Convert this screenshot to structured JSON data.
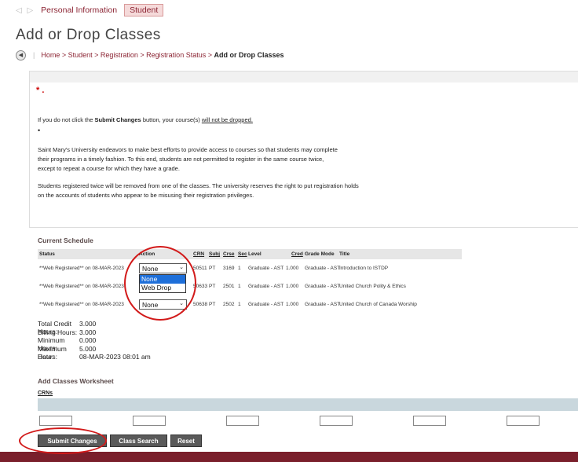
{
  "nav": {
    "arrows": "◁ ▷",
    "tab_personal": "Personal Information",
    "tab_student": "Student"
  },
  "page_title": "Add or Drop Classes",
  "breadcrumb": {
    "back": "◀",
    "sep": "|",
    "path": "Home > Student > Registration > Registration Status > ",
    "current": "Add or Drop Classes"
  },
  "info": {
    "star": "* .",
    "submit_pre": "If you do not click the ",
    "submit_bold": "Submit Changes",
    "submit_mid": " button, your course(s) ",
    "submit_underline": "will not be dropped.",
    "bullet": "•",
    "p1_line1": "Saint Mary's University endeavors to make best efforts to provide access to courses so that students may complete",
    "p1_line2": "their programs in a timely fashion. To this end, students are not permitted to register in the same course twice,",
    "p1_line3": "except to repeat a course for which they have a grade.",
    "p2_line1": "Students registered twice will be removed from one of the classes. The university reserves the right to put registration holds",
    "p2_line2": "on the accounts of students who appear to be misusing their registration privileges."
  },
  "current_schedule": {
    "title": "Current Schedule",
    "headers": {
      "status": "Status",
      "action": "Action",
      "crn": "CRN",
      "subj": "Subj",
      "crse": "Crse",
      "sec": "Sec",
      "level": "Level",
      "cred": "Cred",
      "grade_mode": "Grade Mode",
      "title": "Title"
    },
    "rows": [
      {
        "status": "**Web Registered** on 08-MAR-2023",
        "action": "None",
        "crn": "50511",
        "subj": "PT",
        "crse": "3169",
        "sec": "1",
        "level": "Graduate - AST",
        "cred": "1.000",
        "grade_mode": "Graduate - AST",
        "title": "Introduction to ISTDP"
      },
      {
        "status": "**Web Registered** on 08-MAR-2023",
        "action": "None",
        "crn": "50633",
        "subj": "PT",
        "crse": "2501",
        "sec": "1",
        "level": "Graduate - AST",
        "cred": "1.000",
        "grade_mode": "Graduate - AST",
        "title": "United Church Polity & Ethics"
      },
      {
        "status": "**Web Registered** on 08-MAR-2023",
        "action": "None",
        "crn": "50638",
        "subj": "PT",
        "crse": "2502",
        "sec": "1",
        "level": "Graduate - AST",
        "cred": "1.000",
        "grade_mode": "Graduate - AST",
        "title": "United Church of Canada Worship"
      }
    ],
    "dropdown_options": [
      "None",
      "Web Drop"
    ]
  },
  "totals": [
    {
      "k": "Total Credit Hours:",
      "v": "3.000"
    },
    {
      "k": "Billing Hours:",
      "v": "3.000"
    },
    {
      "k": "Minimum Hours:",
      "v": "0.000"
    },
    {
      "k": "Maximum Hours:",
      "v": "5.000"
    },
    {
      "k": "Date:",
      "v": "08-MAR-2023 08:01 am"
    }
  ],
  "worksheet": {
    "title": "Add Classes Worksheet",
    "crns_label": "CRNs"
  },
  "buttons": {
    "submit": "Submit Changes",
    "class_search": "Class Search",
    "reset": "Reset"
  },
  "colors": {
    "brand": "#8b2332",
    "annotation": "#d21a1a",
    "footer": "#7a1f2b"
  }
}
